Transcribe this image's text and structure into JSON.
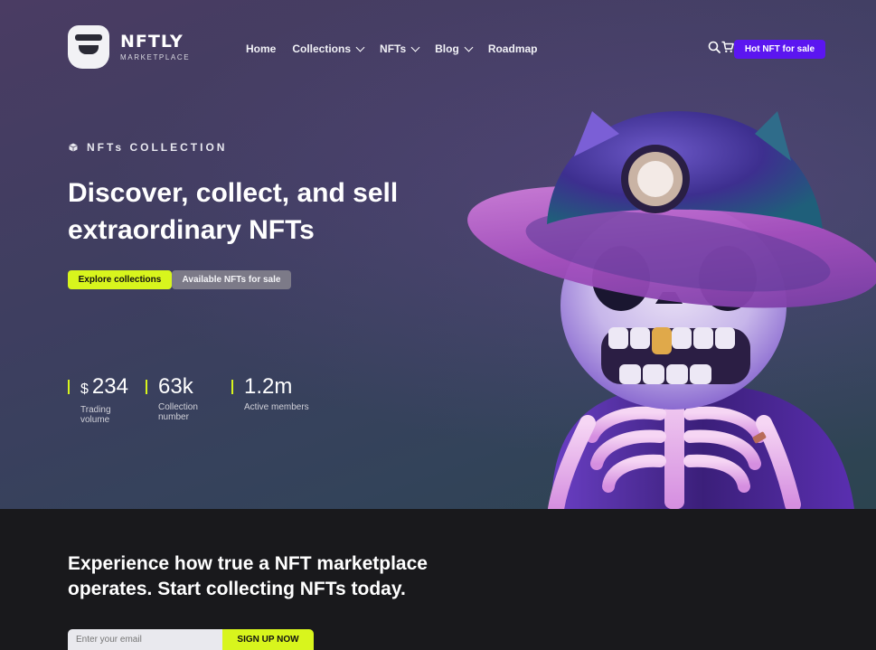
{
  "brand": {
    "title": "NFTLY",
    "subtitle": "MARKETPLACE",
    "logo_icon": "ninja-mask-icon"
  },
  "nav": {
    "items": [
      {
        "label": "Home",
        "dropdown": false
      },
      {
        "label": "Collections",
        "dropdown": true
      },
      {
        "label": "NFTs",
        "dropdown": true
      },
      {
        "label": "Blog",
        "dropdown": true
      },
      {
        "label": "Roadmap",
        "dropdown": false
      }
    ],
    "search_icon": "search-icon",
    "cart_icon": "cart-icon",
    "hot_button": "Hot NFT for sale"
  },
  "hero": {
    "eyebrow": "NFTs COLLECTION",
    "eyebrow_icon": "cube-icon",
    "heading": "Discover, collect, and sell extraordinary NFTs",
    "primary_button": "Explore collections",
    "secondary_button": "Available NFTs for sale",
    "stats": [
      {
        "currency": "$",
        "value": "234",
        "label": "Trading volume"
      },
      {
        "currency": "",
        "value": "63k",
        "label": "Collection number"
      },
      {
        "currency": "",
        "value": "1.2m",
        "label": "Active members"
      }
    ],
    "image": "skeleton-character-with-helmet"
  },
  "newsletter": {
    "heading": "Experience how true a NFT marketplace operates. Start collecting NFTs today.",
    "email_placeholder": "Enter your email",
    "signup_button": "SIGN UP NOW"
  },
  "colors": {
    "accent_lime": "#d8f51d",
    "accent_purple": "#5b16f0",
    "dark_bg": "#19191c"
  }
}
